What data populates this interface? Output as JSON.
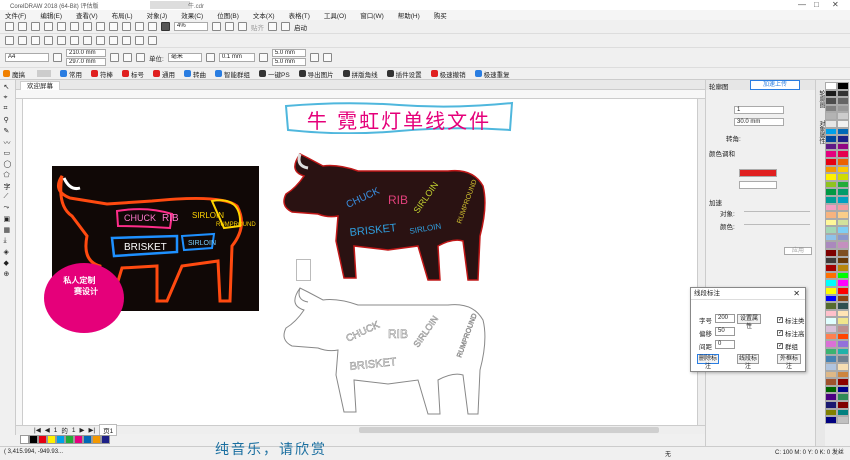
{
  "titlebar": {
    "app_title": "CorelDRAW 2018 (64-Bit) 评估版",
    "file_name": "牛.cdr"
  },
  "menubar": {
    "items": [
      "文件(F)",
      "编辑(E)",
      "查看(V)",
      "布局(L)",
      "对象(J)",
      "效果(C)",
      "位图(B)",
      "文本(X)",
      "表格(T)",
      "工具(O)",
      "窗口(W)",
      "帮助(H)",
      "购买"
    ]
  },
  "toolbar1": {
    "zoom_value": "4%",
    "snap_label": "贴齐",
    "launch_label": "启动"
  },
  "propbar": {
    "page_size": "A4",
    "width": "210.0 mm",
    "height": "297.0 mm",
    "units_label": "单位:",
    "units_value": "毫米",
    "nudge": "0.1 mm",
    "dup_x": "5.0 mm",
    "dup_y": "5.0 mm"
  },
  "pluginbar": {
    "items": [
      "魔搞",
      "常用",
      "符棒",
      "标号",
      "通用",
      "转曲",
      "智能群组",
      "一键PS",
      "导出图片",
      "拼版角线",
      "插件设置",
      "极速撤销",
      "极速重复"
    ]
  },
  "doctab": {
    "label": "欢迎屏幕"
  },
  "canvas": {
    "banner_text": "牛 霓虹灯单线文件",
    "badge_text": "私人定制       赛设计",
    "cow_labels": [
      "CHUCK",
      "RIB",
      "SIRLOIN",
      "BRISKET",
      "SIRLOIN",
      "RUMPROUND"
    ]
  },
  "docker": {
    "title": "轮廓图",
    "upload_button": "加速上传",
    "steps_value": "1",
    "offset_value": "30.0 mm",
    "corner_label": "转角:",
    "color_blend_label": "颜色调和",
    "accelerate_label": "加速",
    "object_label": "对象:",
    "color_label": "颜色:",
    "apply_button": "应用",
    "accent_color": "#e02020"
  },
  "vtabs": [
    "对象属性",
    "轮廓图"
  ],
  "dialog": {
    "title": "线段标注",
    "font_size_label": "字号",
    "font_size_value": "200",
    "set_props_button": "设置属性",
    "offset_label": "偏移",
    "offset_value": "50",
    "gap_label": "间距",
    "gap_value": "0",
    "cb_total": "标注类",
    "cb_height": "标注高",
    "cb_group": "群组",
    "btn_delete": "删除标注",
    "btn_line": "线段标注",
    "btn_outer": "外框标注"
  },
  "page_nav": {
    "current": "1",
    "of": "的",
    "total": "1",
    "page_tab": "页1"
  },
  "subtitle": "纯音乐，请欣赏",
  "status": {
    "coords": "( 3,415.994, -949.93...",
    "fill_none": "无",
    "color_readout": "C: 100 M: 0 Y: 0 K: 0  发丝"
  },
  "palette_colors": [
    "#ffffff",
    "#000000",
    "#1a1a1a",
    "#333333",
    "#4d4d4d",
    "#666666",
    "#808080",
    "#999999",
    "#b3b3b3",
    "#cccccc",
    "#e6e6e6",
    "#f2f2f2",
    "#00a0e9",
    "#0068b7",
    "#00479d",
    "#1d2088",
    "#601986",
    "#920783",
    "#e4007f",
    "#e5004f",
    "#e60012",
    "#eb6100",
    "#f39800",
    "#fcc800",
    "#fff100",
    "#cfdb00",
    "#8fc31f",
    "#22ac38",
    "#009944",
    "#009b6b",
    "#009e96",
    "#00a0c1",
    "#f19ec2",
    "#f29c9f",
    "#f6b37f",
    "#facd89",
    "#fff799",
    "#d2e29c",
    "#a3d6b6",
    "#7ecef4",
    "#8fc2e9",
    "#8c97cb",
    "#aa89bd",
    "#c490bf",
    "#7d0000",
    "#7f4f21",
    "#3e3a39",
    "#6a3906",
    "#a40000",
    "#b8860b",
    "#ff6f00",
    "#00ff00",
    "#00ffff",
    "#ff00ff",
    "#ffff00",
    "#ff0000",
    "#0000ff",
    "#8b4513",
    "#556b2f",
    "#2f4f4f",
    "#ffc0cb",
    "#ffe4b5",
    "#e0ffff",
    "#f0e68c",
    "#d8bfd8",
    "#bc8f8f",
    "#ff7f50",
    "#ff4500",
    "#da70d6",
    "#9370db",
    "#3cb371",
    "#20b2aa",
    "#4682b4",
    "#708090",
    "#b0c4de",
    "#f5deb3",
    "#deb887",
    "#cd853f",
    "#a0522d",
    "#8b0000",
    "#006400",
    "#00008b",
    "#4b0082",
    "#2e8b57",
    "#191970",
    "#800000",
    "#808000",
    "#008080",
    "#000080",
    "#c0c0c0"
  ],
  "bottom_palette": [
    "#ffffff",
    "#000000",
    "#e60012",
    "#fff100",
    "#00a0e9",
    "#22ac38",
    "#e4007f",
    "#0068b7",
    "#f39800",
    "#1d2088"
  ]
}
